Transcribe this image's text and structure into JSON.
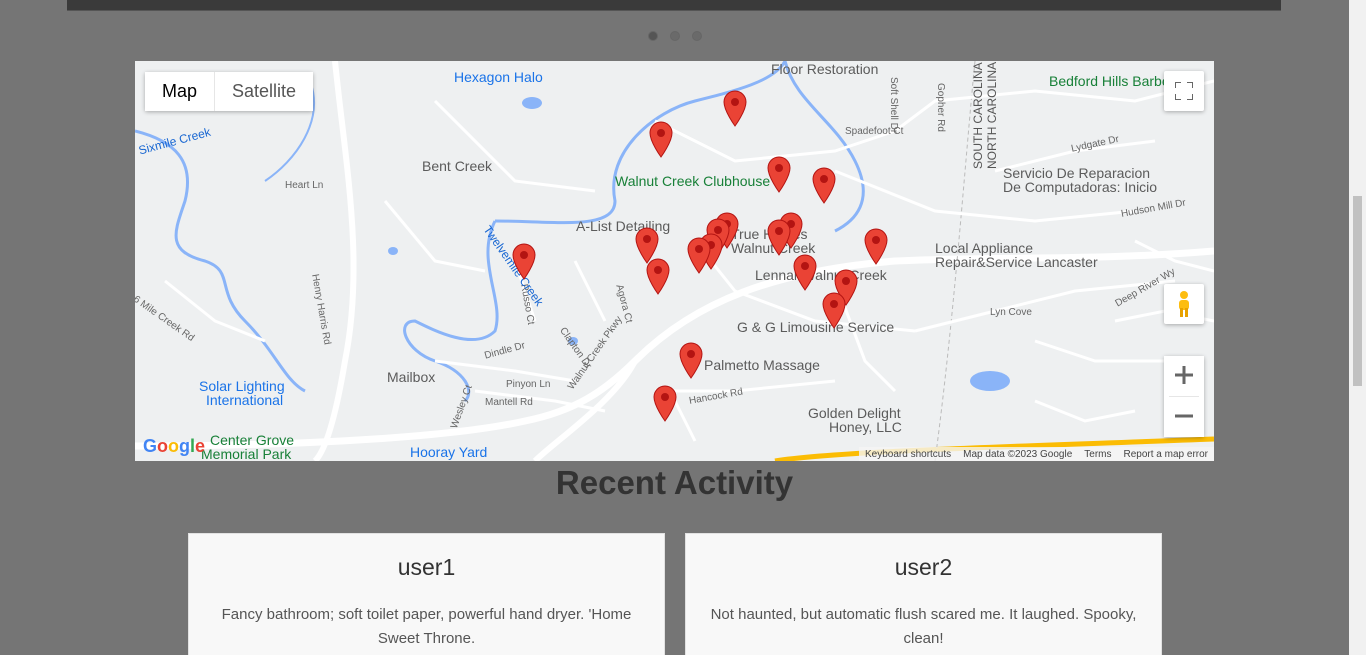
{
  "carousel": {
    "dots": 3,
    "active_dot": 0
  },
  "map": {
    "type_buttons": [
      "Map",
      "Satellite"
    ],
    "active_type": "Map",
    "places": [
      {
        "name": "Hexagon Halo",
        "style": "blue"
      },
      {
        "name": "Floor Restoration",
        "style": "dark"
      },
      {
        "name": "Bedford Hills Barbe",
        "style": "green"
      },
      {
        "name": "Bent Creek",
        "style": "dark"
      },
      {
        "name": "Walnut Creek Clubhouse",
        "style": "green"
      },
      {
        "name": "Servicio De Reparacion",
        "style": "dark"
      },
      {
        "name": "De Computadoras: Inicio",
        "style": "dark"
      },
      {
        "name": "A-List Detailing",
        "style": "dark"
      },
      {
        "name": "True Homes",
        "style": "dark"
      },
      {
        "name": "Walnut Creek",
        "style": "dark"
      },
      {
        "name": "Local Appliance",
        "style": "dark"
      },
      {
        "name": "Repair&Service Lancaster",
        "style": "dark"
      },
      {
        "name": "Lennar Walnut Creek",
        "style": "dark"
      },
      {
        "name": "G & G Limousine Service",
        "style": "dark"
      },
      {
        "name": "Palmetto Massage",
        "style": "dark"
      },
      {
        "name": "Mailbox",
        "style": "dark"
      },
      {
        "name": "Solar Lighting",
        "style": "blue"
      },
      {
        "name": "International",
        "style": "blue"
      },
      {
        "name": "Golden Delight",
        "style": "dark"
      },
      {
        "name": "Honey, LLC",
        "style": "dark"
      },
      {
        "name": "Center Grove",
        "style": "green"
      },
      {
        "name": "Memorial Park",
        "style": "green"
      },
      {
        "name": "Hooray Yard",
        "style": "blue"
      }
    ],
    "roads": [
      "Heart Ln",
      "Henry Harris Rd",
      "Russo Ct",
      "Clapton Dr",
      "Agora Ct",
      "Walnut Creek Pkwy",
      "Dindle Dr",
      "Pinyon Ln",
      "Mantell Rd",
      "Wesley Ct",
      "Hancock Rd",
      "Spadefoot Ct",
      "Soft Shell Dr",
      "Gopher Rd",
      "Lydgate Dr",
      "Hudson Mill Dr",
      "Deep River Wy",
      "Lyn Cove",
      "6 Mile Creek Rd",
      "SOUTH CAROLINA",
      "NORTH CAROLINA"
    ],
    "water": [
      "Sixmile Creek",
      "Twelvemile Creek"
    ],
    "attribution": [
      "Keyboard shortcuts",
      "Map data ©2023 Google",
      "Terms",
      "Report a map error"
    ],
    "logo": "Google",
    "pin_color": "#ea4335"
  },
  "recent_activity": {
    "title": "Recent Activity",
    "cards": [
      {
        "user": "user1",
        "text": "Fancy bathroom; soft toilet paper, powerful hand dryer. 'Home Sweet Throne."
      },
      {
        "user": "user2",
        "text": "Not haunted, but automatic flush scared me. It laughed. Spooky, clean!"
      }
    ]
  }
}
